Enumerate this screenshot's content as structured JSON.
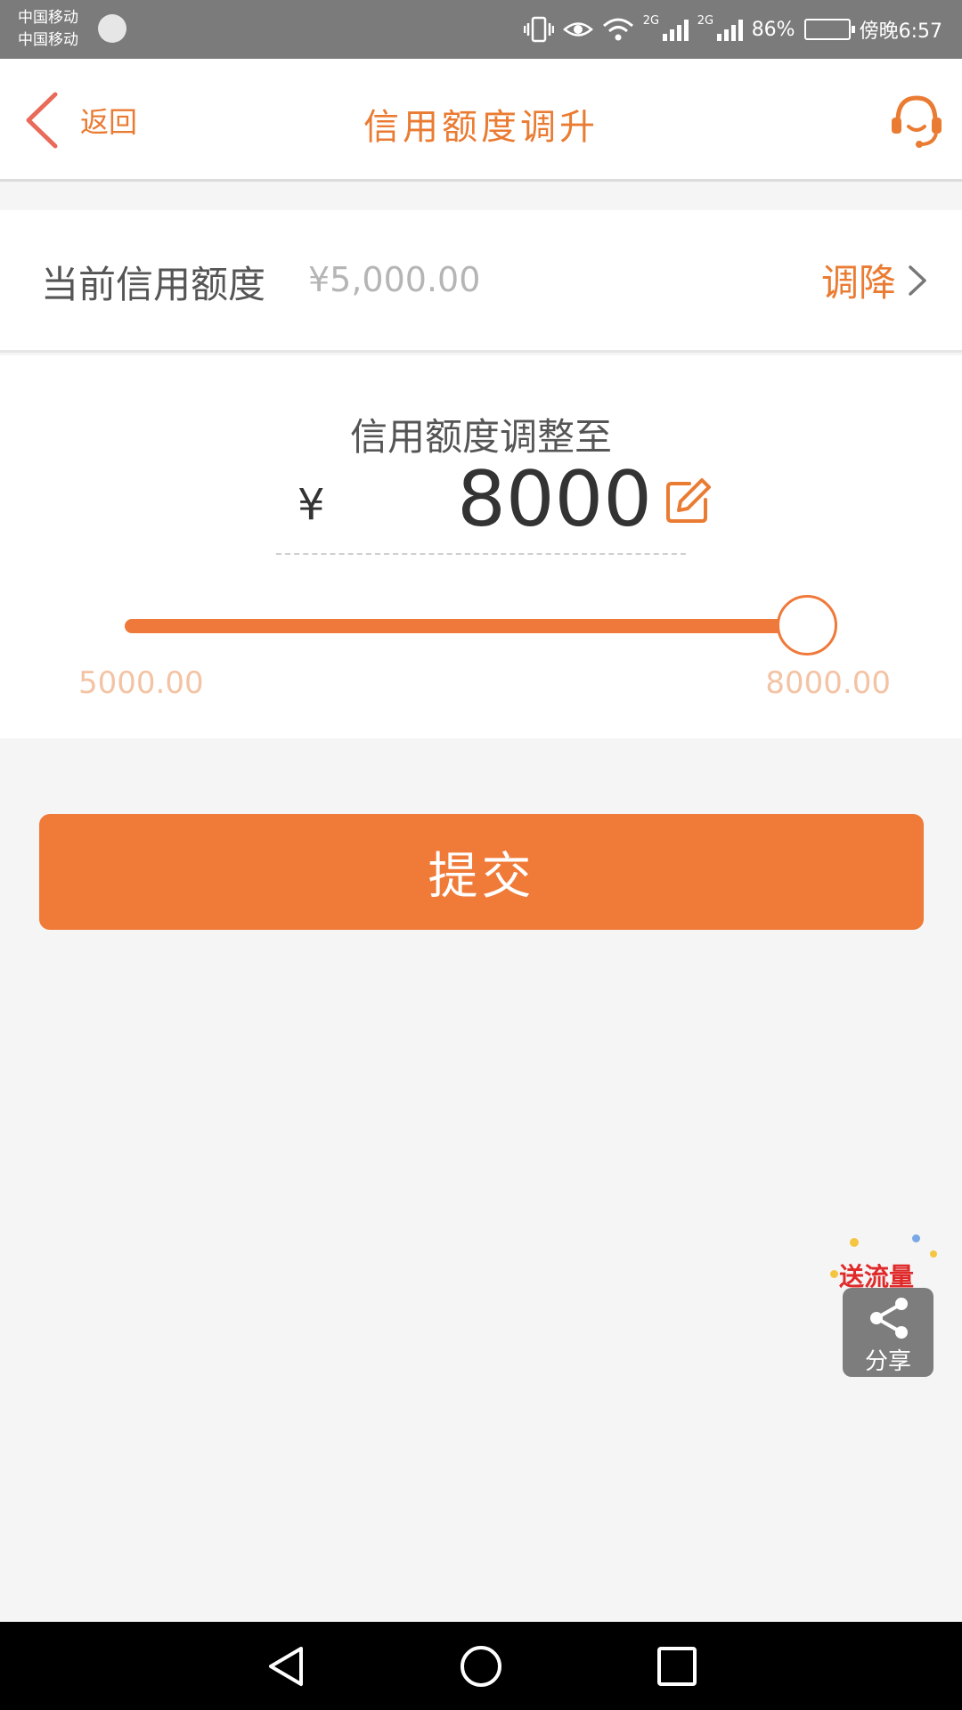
{
  "status_bar": {
    "carrier_1": "中国移动",
    "carrier_2": "中国移动",
    "network_1": "2G",
    "network_2": "2G",
    "battery_percent": "86%",
    "time": "傍晚6:57"
  },
  "header": {
    "back_label": "返回",
    "title": "信用额度调升",
    "back_icon": "chevron-left-icon",
    "support_icon": "headset-icon"
  },
  "current_credit": {
    "label": "当前信用额度",
    "value": "¥5,000.00",
    "decrease_label": "调降"
  },
  "adjust": {
    "title": "信用额度调整至",
    "currency_symbol": "¥",
    "amount": "8000",
    "slider": {
      "min_label": "5000.00",
      "max_label": "8000.00",
      "min": 5000,
      "max": 8000,
      "value": 8000
    }
  },
  "submit_label": "提交",
  "share": {
    "promo": "送流量",
    "label": "分享"
  },
  "colors": {
    "accent": "#ef793a",
    "accent_light": "#f3c3a4",
    "status_bar": "#7b7b7b"
  }
}
